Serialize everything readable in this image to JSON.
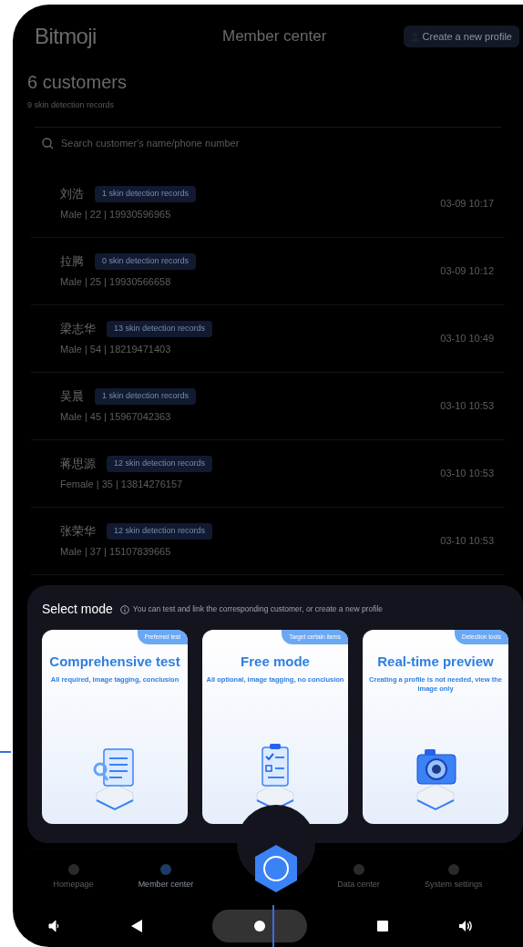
{
  "header": {
    "logo": "Bitmoji",
    "title": "Member center",
    "create_button": "Create a new profile"
  },
  "summary": {
    "count": "6 customers",
    "subtitle": "9 skin detection records"
  },
  "search": {
    "placeholder": "Search customer's name/phone number"
  },
  "customers": [
    {
      "name": "刘浩",
      "badge": "1 skin detection records",
      "details": "Male | 22 | 19930596965",
      "time": "03-09 10:17"
    },
    {
      "name": "拉腾",
      "badge": "0 skin detection records",
      "details": "Male | 25 | 19930566658",
      "time": "03-09 10:12"
    },
    {
      "name": "梁志华",
      "badge": "13 skin detection records",
      "details": "Male | 54 | 18219471403",
      "time": "03-10 10:49"
    },
    {
      "name": "吴晨",
      "badge": "1 skin detection records",
      "details": "Male | 45 | 15967042363",
      "time": "03-10 10:53"
    },
    {
      "name": "蒋思源",
      "badge": "12 skin detection records",
      "details": "Female | 35 | 13814276157",
      "time": "03-10 10:53"
    },
    {
      "name": "张荣华",
      "badge": "12 skin detection records",
      "details": "Male | 37 | 15107839665",
      "time": "03-10 10:53"
    }
  ],
  "modal": {
    "title": "Select mode",
    "hint": "You can test and link the corresponding customer, or create a new profile",
    "modes": [
      {
        "kind": "document",
        "tag": "Preferred test",
        "title": "Comprehensive test",
        "description": "All required, image tagging, conclusion"
      },
      {
        "kind": "checklist",
        "tag": "Target certain items",
        "title": "Free mode",
        "description": "All optional, image tagging, no conclusion"
      },
      {
        "kind": "camera",
        "tag": "Detection tools",
        "title": "Real-time preview",
        "description": "Creating a profile is not needed, view the image only"
      }
    ]
  },
  "bottom_nav": [
    {
      "label": "Homepage",
      "selected": false
    },
    {
      "label": "Member center",
      "selected": true
    },
    {
      "label": "Data center",
      "selected": false
    },
    {
      "label": "System settings",
      "selected": false
    }
  ]
}
